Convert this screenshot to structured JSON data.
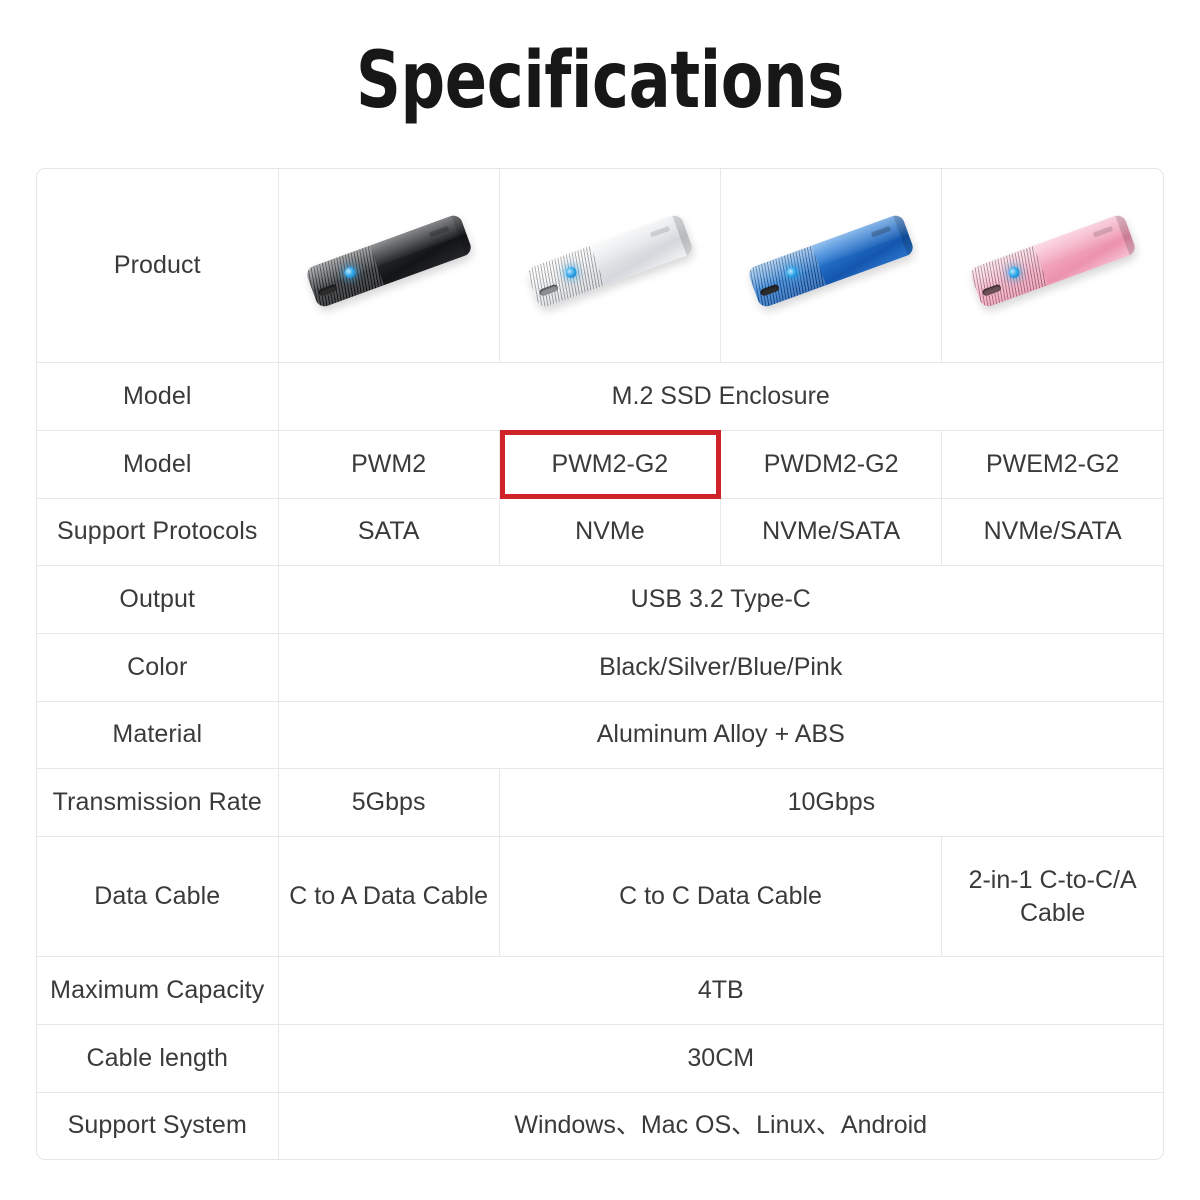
{
  "page": {
    "title": "Specifications",
    "accent_red": "#cf2229",
    "border_color": "#e6e8ea",
    "background": "#ffffff"
  },
  "table": {
    "columns": [
      "PWM2",
      "PWM2-G2",
      "PWDM2-G2",
      "PWEM2-G2"
    ],
    "highlighted_column": "PWM2-G2",
    "rows": [
      {
        "label": "Product",
        "type": "images",
        "products": [
          {
            "color_name": "Black",
            "swatch": "#1a1c1f"
          },
          {
            "color_name": "Silver",
            "swatch": "#e8eaec"
          },
          {
            "color_name": "Blue",
            "swatch": "#2a78d0"
          },
          {
            "color_name": "Pink",
            "swatch": "#f2abc3"
          }
        ]
      },
      {
        "label": "Model",
        "type": "merged",
        "value": "M.2 SSD Enclosure"
      },
      {
        "label": "Model",
        "type": "cells",
        "values": [
          "PWM2",
          "PWM2-G2",
          "PWDM2-G2",
          "PWEM2-G2"
        ],
        "highlight_index": 1
      },
      {
        "label": "Support Protocols",
        "type": "cells",
        "values": [
          "SATA",
          "NVMe",
          "NVMe/SATA",
          "NVMe/SATA"
        ]
      },
      {
        "label": "Output",
        "type": "merged",
        "value": "USB 3.2 Type-C"
      },
      {
        "label": "Color",
        "type": "merged",
        "value": "Black/Silver/Blue/Pink"
      },
      {
        "label": "Material",
        "type": "merged",
        "value": "Aluminum Alloy + ABS"
      },
      {
        "label": "Transmission Rate",
        "type": "split",
        "values": [
          "5Gbps",
          "10Gbps"
        ]
      },
      {
        "label": "Data Cable",
        "type": "split3",
        "values": [
          "C to A Data Cable",
          "C to C Data Cable",
          "2-in-1 C-to-C/A Cable"
        ]
      },
      {
        "label": "Maximum Capacity",
        "type": "merged",
        "value": "4TB"
      },
      {
        "label": "Cable length",
        "type": "merged",
        "value": "30CM"
      },
      {
        "label": "Support System",
        "type": "merged",
        "value": "Windows、Mac OS、Linux、Android"
      }
    ]
  }
}
